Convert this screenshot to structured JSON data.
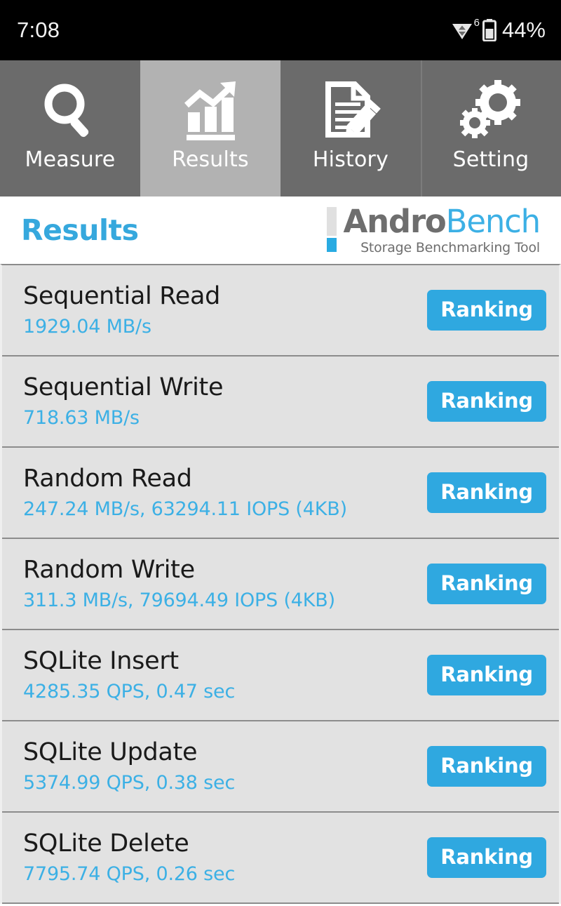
{
  "status_bar": {
    "time": "7:08",
    "wifi_generation": "6",
    "battery_percent": "44%",
    "wifi_icon": "wifi-data-transfer-icon",
    "battery_icon": "battery-icon"
  },
  "tabs": [
    {
      "label": "Measure",
      "icon": "magnifier-icon",
      "active": false
    },
    {
      "label": "Results",
      "icon": "bar-chart-trend-icon",
      "active": true
    },
    {
      "label": "History",
      "icon": "document-pencil-icon",
      "active": false
    },
    {
      "label": "Setting",
      "icon": "gears-icon",
      "active": false
    }
  ],
  "header": {
    "title": "Results",
    "logo_primary": "Andro",
    "logo_secondary": "Bench",
    "logo_tagline": "Storage Benchmarking Tool"
  },
  "results": [
    {
      "name": "Sequential Read",
      "value": "1929.04 MB/s",
      "button": "Ranking"
    },
    {
      "name": "Sequential Write",
      "value": "718.63 MB/s",
      "button": "Ranking"
    },
    {
      "name": "Random Read",
      "value": "247.24 MB/s, 63294.11 IOPS (4KB)",
      "button": "Ranking"
    },
    {
      "name": "Random Write",
      "value": "311.3 MB/s, 79694.49 IOPS (4KB)",
      "button": "Ranking"
    },
    {
      "name": "SQLite Insert",
      "value": "4285.35 QPS, 0.47 sec",
      "button": "Ranking"
    },
    {
      "name": "SQLite Update",
      "value": "5374.99 QPS, 0.38 sec",
      "button": "Ranking"
    },
    {
      "name": "SQLite Delete",
      "value": "7795.74 QPS, 0.26 sec",
      "button": "Ranking"
    }
  ],
  "colors": {
    "accent_blue": "#3cb0e5",
    "button_blue": "#2fa8e0",
    "tab_inactive": "#6b6b6b",
    "tab_active": "#b2b2b2",
    "row_background": "#e2e2e2",
    "status_bar": "#000000"
  }
}
